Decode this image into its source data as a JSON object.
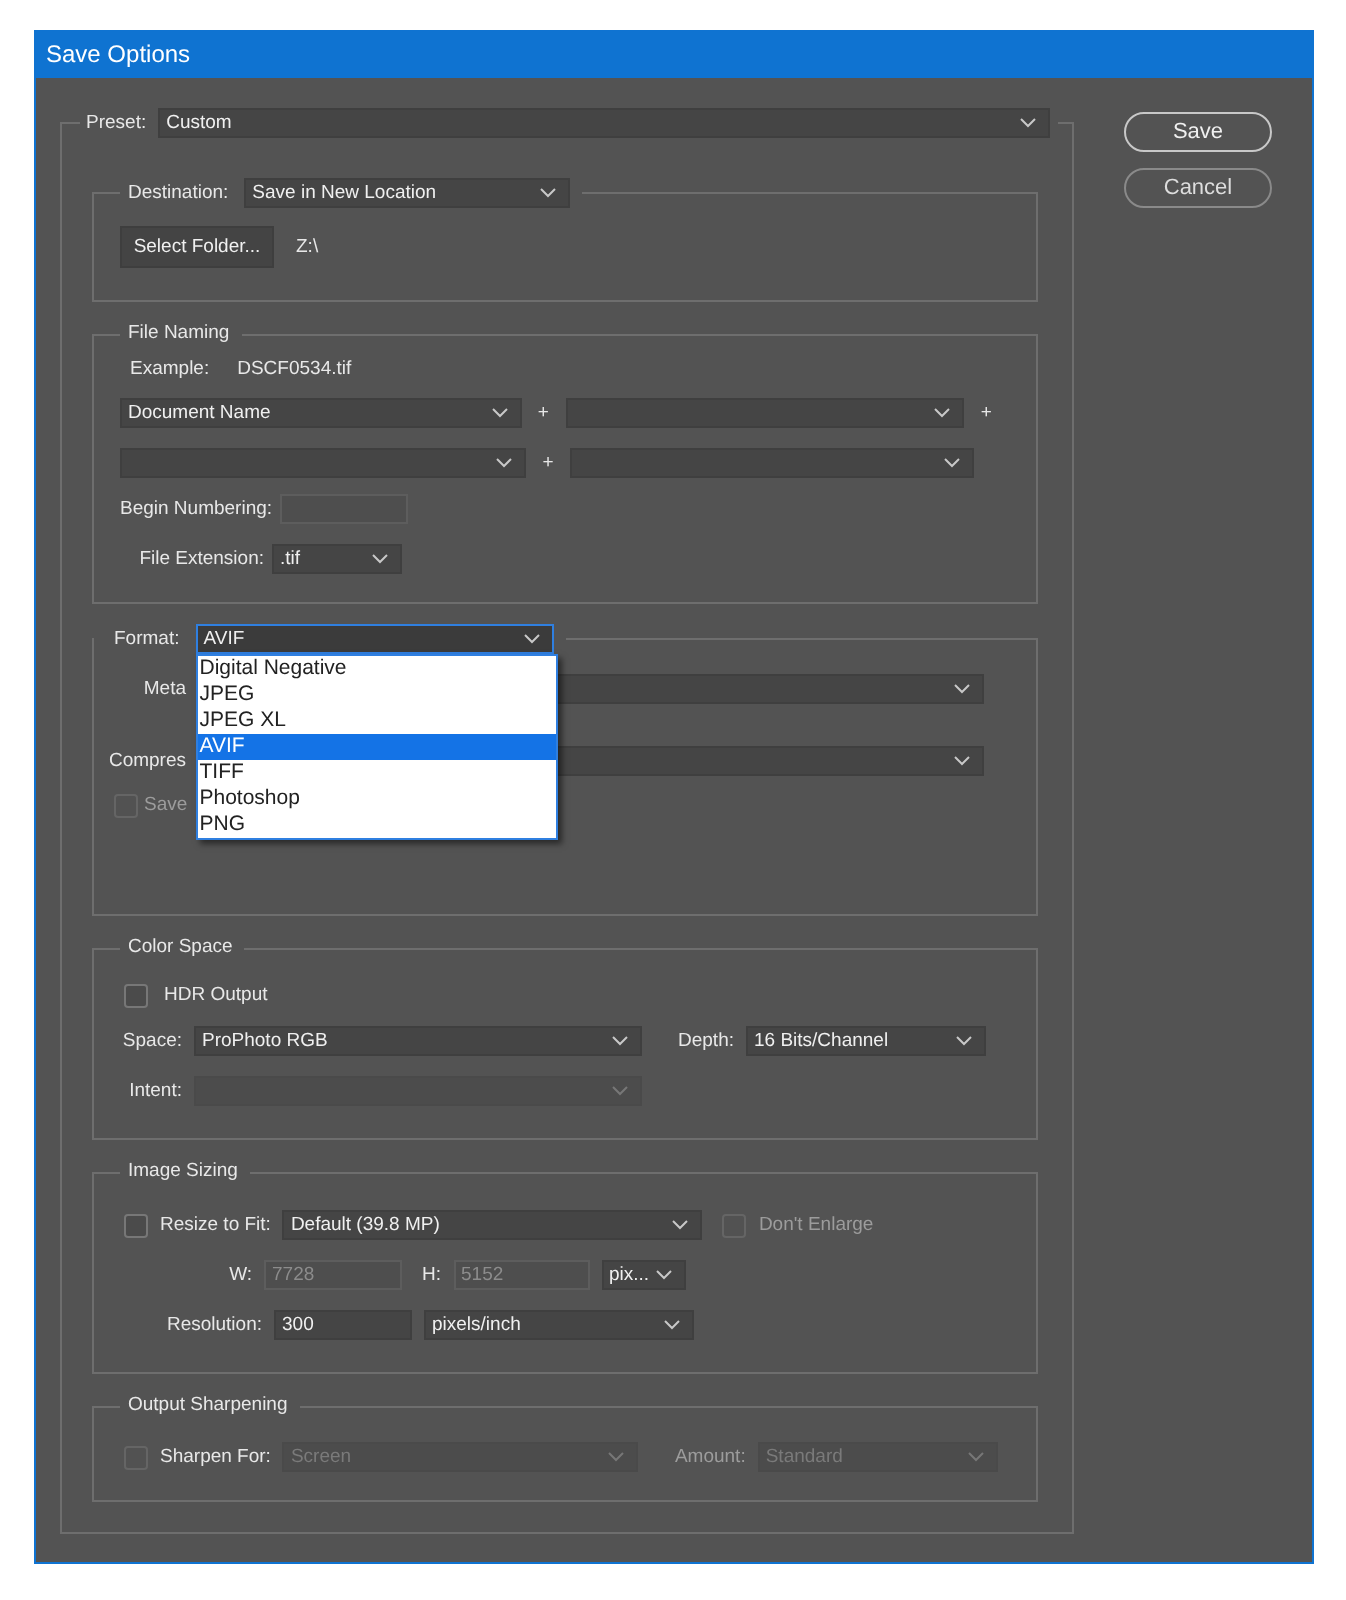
{
  "window": {
    "title": "Save Options"
  },
  "preset": {
    "label": "Preset:",
    "value": "Custom"
  },
  "buttons": [
    {
      "label": "Save",
      "default": true
    },
    {
      "label": "Cancel",
      "default": false
    }
  ],
  "destination": {
    "label": "Destination:",
    "value": "Save in New Location",
    "button": "Select Folder...",
    "path": "Z:\\"
  },
  "file_naming": {
    "title": "File Naming",
    "example_label": "Example:",
    "example": "DSCF0534.tif",
    "rows": [
      {
        "fields": [
          {
            "value": "Document Name",
            "disabled": false
          },
          {
            "disabled": false
          }
        ],
        "plus": [
          "+",
          "+"
        ]
      },
      {
        "fields": [
          {
            "disabled": false
          },
          {
            "disabled": false
          }
        ],
        "plus": [
          "+"
        ]
      }
    ],
    "begin_numbering": {
      "label": "Begin Numbering:",
      "disabled": true
    },
    "file_extension": {
      "label": "File Extension:",
      "value": ".tif"
    }
  },
  "format": {
    "label": "Format:",
    "value": "AVIF",
    "expanded": true,
    "options": [
      {
        "label": "Digital Negative",
        "selected": false
      },
      {
        "label": "JPEG",
        "selected": false
      },
      {
        "label": "JPEG XL",
        "selected": false
      },
      {
        "label": "AVIF",
        "selected": true
      },
      {
        "label": "TIFF",
        "selected": false
      },
      {
        "label": "Photoshop",
        "selected": false
      },
      {
        "label": "PNG",
        "selected": false
      }
    ],
    "rows": [
      {
        "kind": "select",
        "label": "Meta"
      },
      {
        "kind": "select",
        "label": "Compres"
      },
      {
        "kind": "checkbox",
        "label": "Save",
        "checked": false,
        "disabled": true
      }
    ]
  },
  "color_space": {
    "title": "Color Space",
    "hdr": {
      "label": "HDR Output",
      "checked": false
    },
    "space": {
      "label": "Space:",
      "value": "ProPhoto RGB"
    },
    "depth": {
      "label": "Depth:",
      "value": "16 Bits/Channel"
    },
    "intent": {
      "label": "Intent:",
      "disabled": true
    }
  },
  "image_sizing": {
    "title": "Image Sizing",
    "resize": {
      "label": "Resize to Fit:",
      "checked": false,
      "value": "Default  (39.8 MP)"
    },
    "dont_enlarge": {
      "label": "Don't Enlarge",
      "checked": false,
      "disabled": true
    },
    "width": {
      "label": "W:",
      "value": "7728",
      "disabled": true
    },
    "height": {
      "label": "H:",
      "value": "5152",
      "disabled": true
    },
    "unit": {
      "value": "pix..."
    },
    "resolution": {
      "label": "Resolution:",
      "value": "300"
    },
    "resolution_unit": {
      "value": "pixels/inch"
    }
  },
  "output_sharpening": {
    "title": "Output Sharpening",
    "sharpen": {
      "label": "Sharpen For:",
      "checked": false,
      "value": "Screen",
      "disabled": true
    },
    "amount": {
      "label": "Amount:",
      "value": "Standard",
      "disabled": true
    }
  }
}
